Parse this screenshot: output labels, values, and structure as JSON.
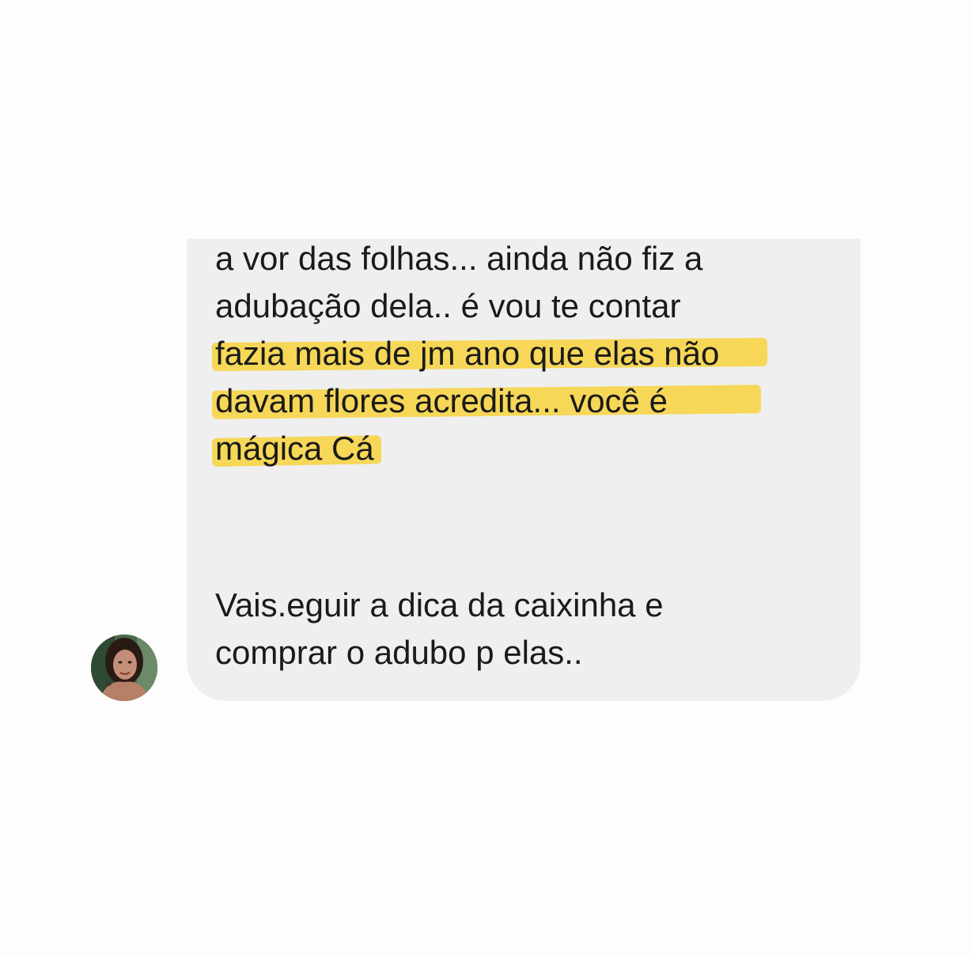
{
  "message": {
    "lines": [
      "a vor das folhas... ainda não fiz a",
      "adubação dela.. é vou te contar",
      "fazia mais de jm ano que elas não",
      "davam flores acredita... você é",
      "mágica Cá",
      "Vais.eguir a dica da caixinha e",
      "comprar o adubo p elas.."
    ],
    "highlight_color": "#f7d23c",
    "bubble_color": "#efefef"
  },
  "avatar": {
    "icon": "user-avatar-photo"
  }
}
